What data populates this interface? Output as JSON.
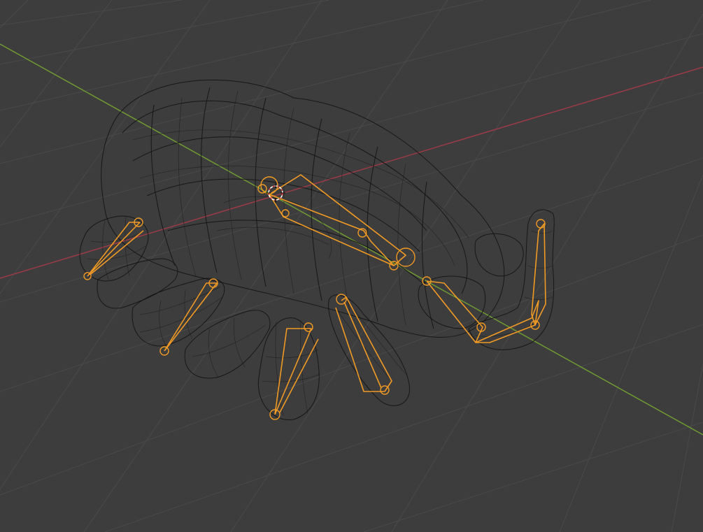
{
  "viewport": {
    "background": "#3d3d3d",
    "grid_color": "#4a4a4a",
    "x_axis_color": "#9b3b47",
    "y_axis_color": "#6f9a33",
    "wire_color": "#111111",
    "armature_color": "#f09a25",
    "cursor_color": "#e04040"
  },
  "scene": {
    "object": "hand-mesh-wireframe",
    "armature": "hand-rig",
    "view": "3d-viewport-perspective",
    "shading": "wireframe"
  }
}
